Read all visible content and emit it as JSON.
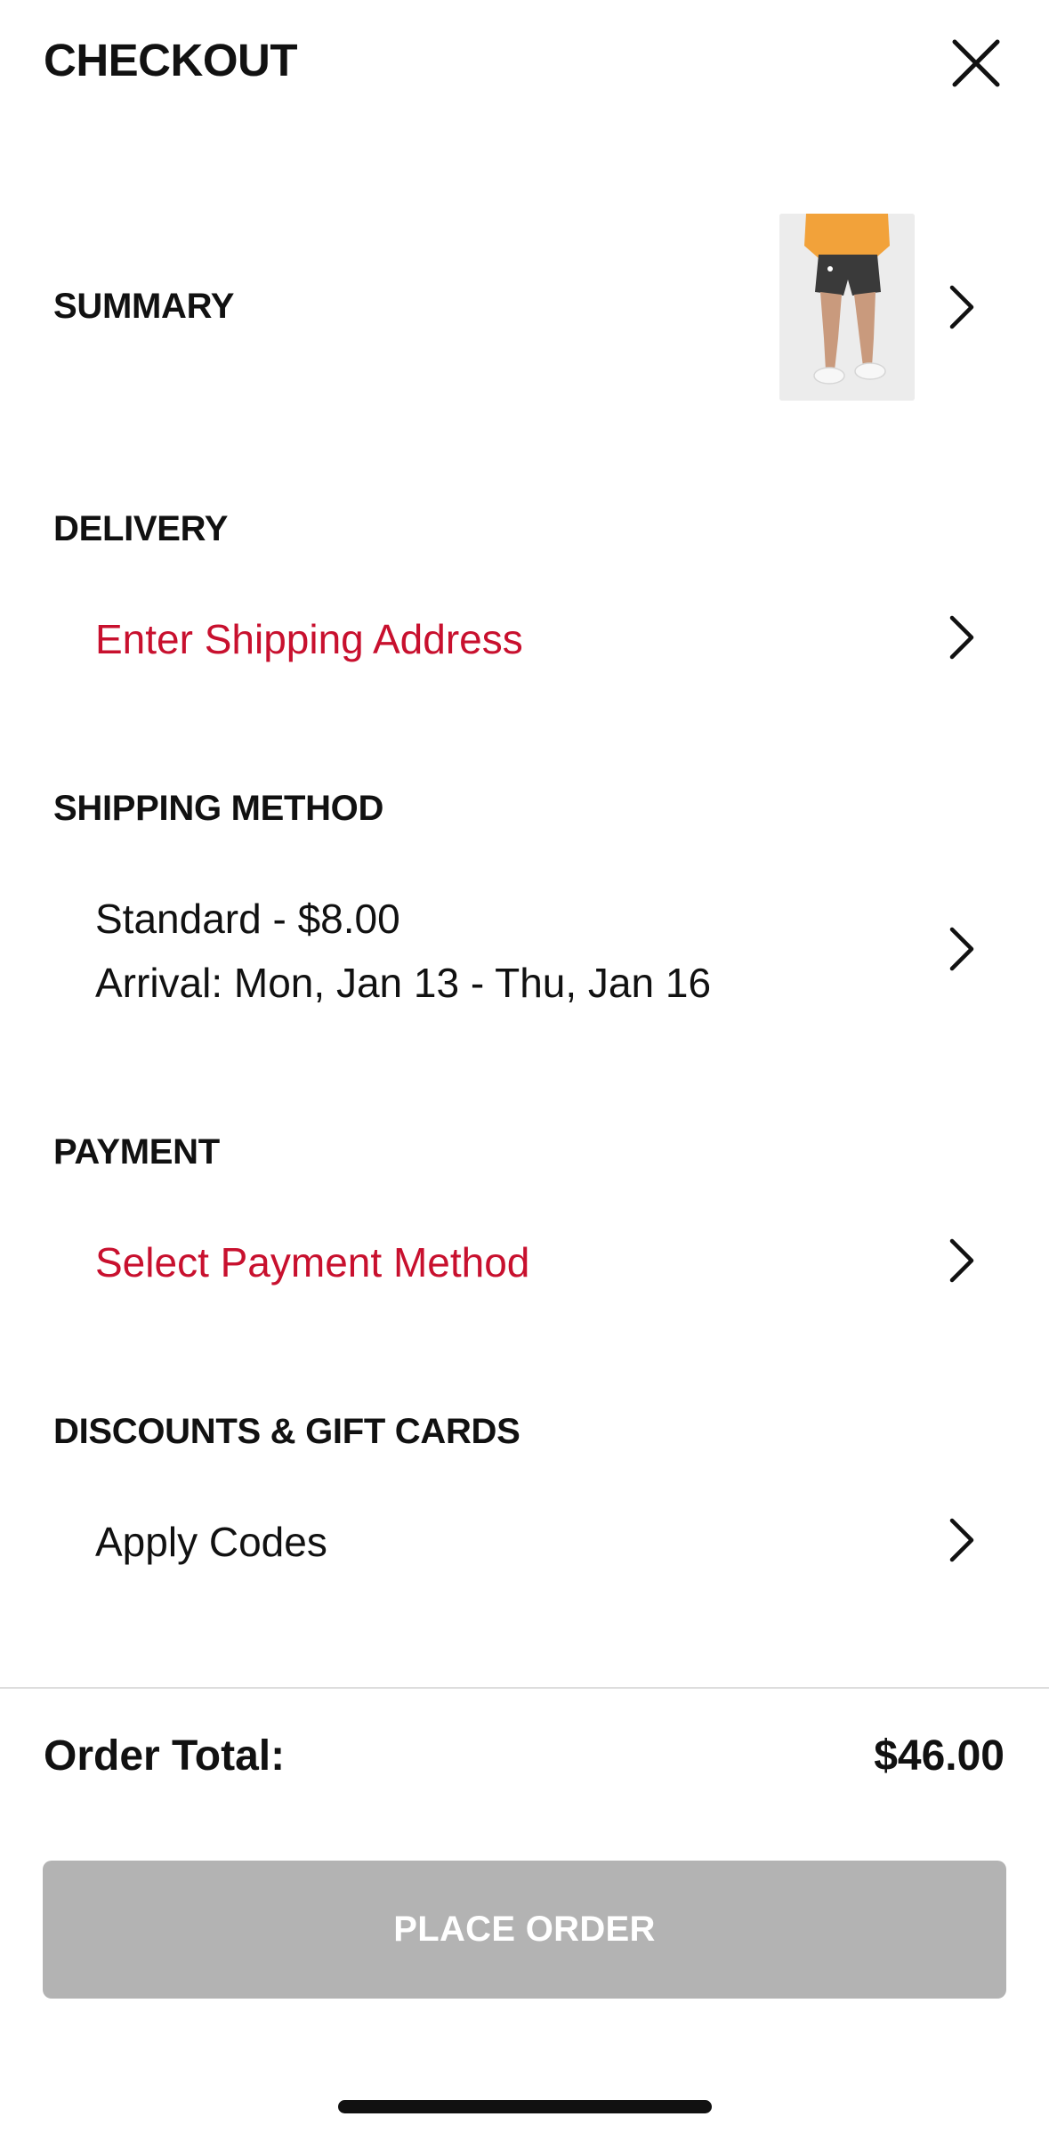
{
  "header": {
    "title": "CHECKOUT",
    "close_icon": "close-icon"
  },
  "summary": {
    "heading": "SUMMARY",
    "product_image": "product-thumbnail",
    "chevron_icon": "chevron-right-icon"
  },
  "delivery": {
    "heading": "DELIVERY",
    "action": "Enter Shipping Address",
    "chevron_icon": "chevron-right-icon"
  },
  "shipping_method": {
    "heading": "SHIPPING METHOD",
    "line1": "Standard - $8.00",
    "line2": "Arrival: Mon, Jan 13 - Thu, Jan 16",
    "chevron_icon": "chevron-right-icon"
  },
  "payment": {
    "heading": "PAYMENT",
    "action": "Select Payment Method",
    "chevron_icon": "chevron-right-icon"
  },
  "discounts": {
    "heading": "DISCOUNTS & GIFT CARDS",
    "action": "Apply Codes",
    "chevron_icon": "chevron-right-icon"
  },
  "footer": {
    "total_label": "Order Total:",
    "total_value": "$46.00",
    "place_order_label": "PLACE ORDER"
  },
  "colors": {
    "accent_red": "#c8102e",
    "button_disabled": "#b3b3b3",
    "text": "#111111"
  }
}
